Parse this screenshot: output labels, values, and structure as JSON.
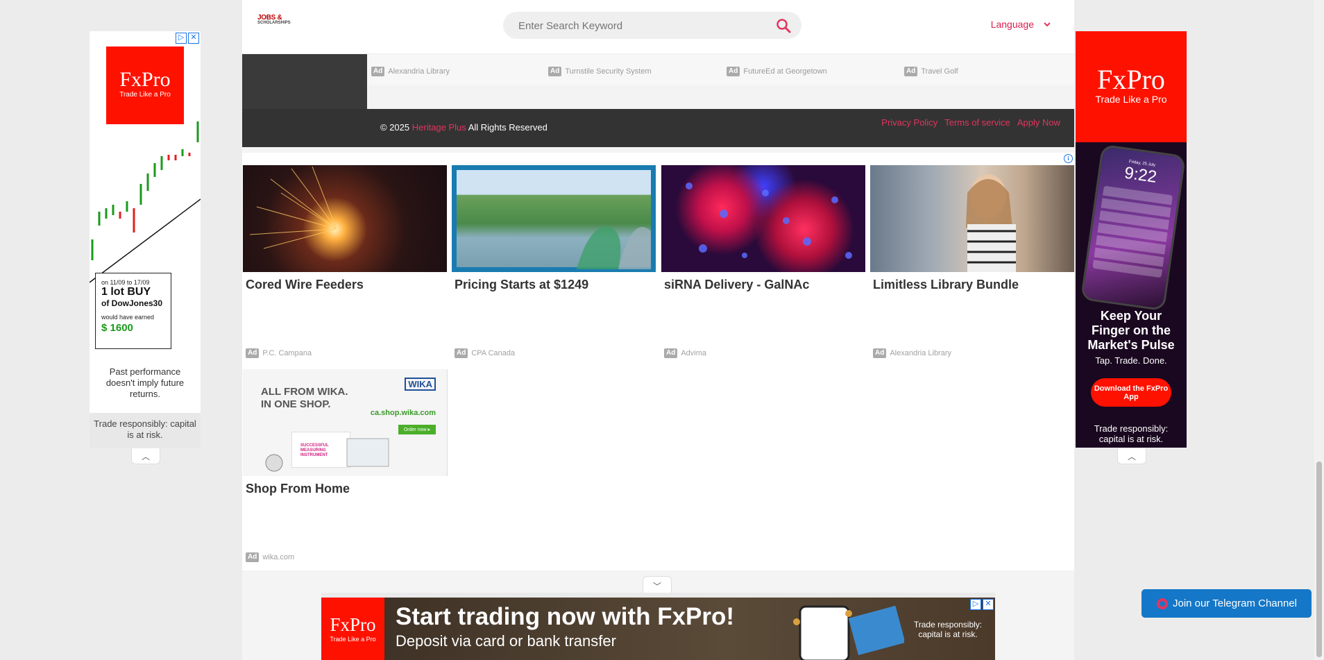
{
  "header": {
    "logo_line1": "JOBS &",
    "logo_line2": "SCHOLARSHIPS",
    "search_placeholder": "Enter Search Keyword",
    "language_label": "Language"
  },
  "sponsored_links": [
    {
      "tag": "Ad",
      "label": "Alexandria Library"
    },
    {
      "tag": "Ad",
      "label": "Turnstile Security System"
    },
    {
      "tag": "Ad",
      "label": "FutureEd at Georgetown"
    },
    {
      "tag": "Ad",
      "label": "Travel Golf"
    }
  ],
  "footer": {
    "copy_prefix": "© 2025",
    "brand": "Heritage Plus",
    "copy_suffix": "All Rights Reserved",
    "links": [
      "Privacy Policy",
      "Terms of service",
      "Apply Now"
    ]
  },
  "native_ads": [
    {
      "title": "Cored Wire Feeders",
      "tag": "Ad",
      "source": "P.C. Campana"
    },
    {
      "title": "Pricing Starts at $1249",
      "tag": "Ad",
      "source": "CPA Canada"
    },
    {
      "title": "siRNA Delivery - GalNAc",
      "tag": "Ad",
      "source": "Advima"
    },
    {
      "title": "Limitless Library Bundle",
      "tag": "Ad",
      "source": "Alexandria Library"
    },
    {
      "title": "Shop From Home",
      "tag": "Ad",
      "source": "wika.com"
    }
  ],
  "wika_ad": {
    "brand": "WIKA",
    "headline_line1": "ALL FROM WIKA.",
    "headline_line2": "IN ONE SHOP.",
    "url": "ca.shop.wika.com",
    "cta": "Order now ▸",
    "box_line1": "SUCCESSFUL",
    "box_line2": "MEASURING",
    "box_line3": "INSTRUMENT"
  },
  "left_ad": {
    "brand": "FxPro",
    "tagline": "Trade Like a Pro",
    "date_range": "on 11/09 to 17/09",
    "lot": "1 lot BUY",
    "instrument": "of DowJones30",
    "would_have": "would have earned",
    "amount": "$ 1600",
    "disclaimer": "Past performance doesn't imply future returns.",
    "risk": "Trade responsibly: capital is at risk."
  },
  "right_ad": {
    "brand": "FxPro",
    "tagline": "Trade Like a Pro",
    "phone_day": "Friday, 25 July",
    "phone_time": "9:22",
    "headline": "Keep Your Finger on the Market's Pulse",
    "sub": "Tap. Trade. Done.",
    "cta": "Download the FxPro App",
    "risk": "Trade responsibly: capital is at risk."
  },
  "bottom_ad": {
    "brand": "FxPro",
    "tagline": "Trade Like a Pro",
    "headline": "Start trading now with FxPro!",
    "sub": "Deposit via card or bank transfer",
    "risk": "Trade responsibly: capital is at risk."
  },
  "telegram": {
    "label": "Join our Telegram Channel"
  },
  "colors": {
    "accent": "#e2355e",
    "fxpro_red": "#ff1100",
    "telegram_blue": "#1477c8"
  }
}
